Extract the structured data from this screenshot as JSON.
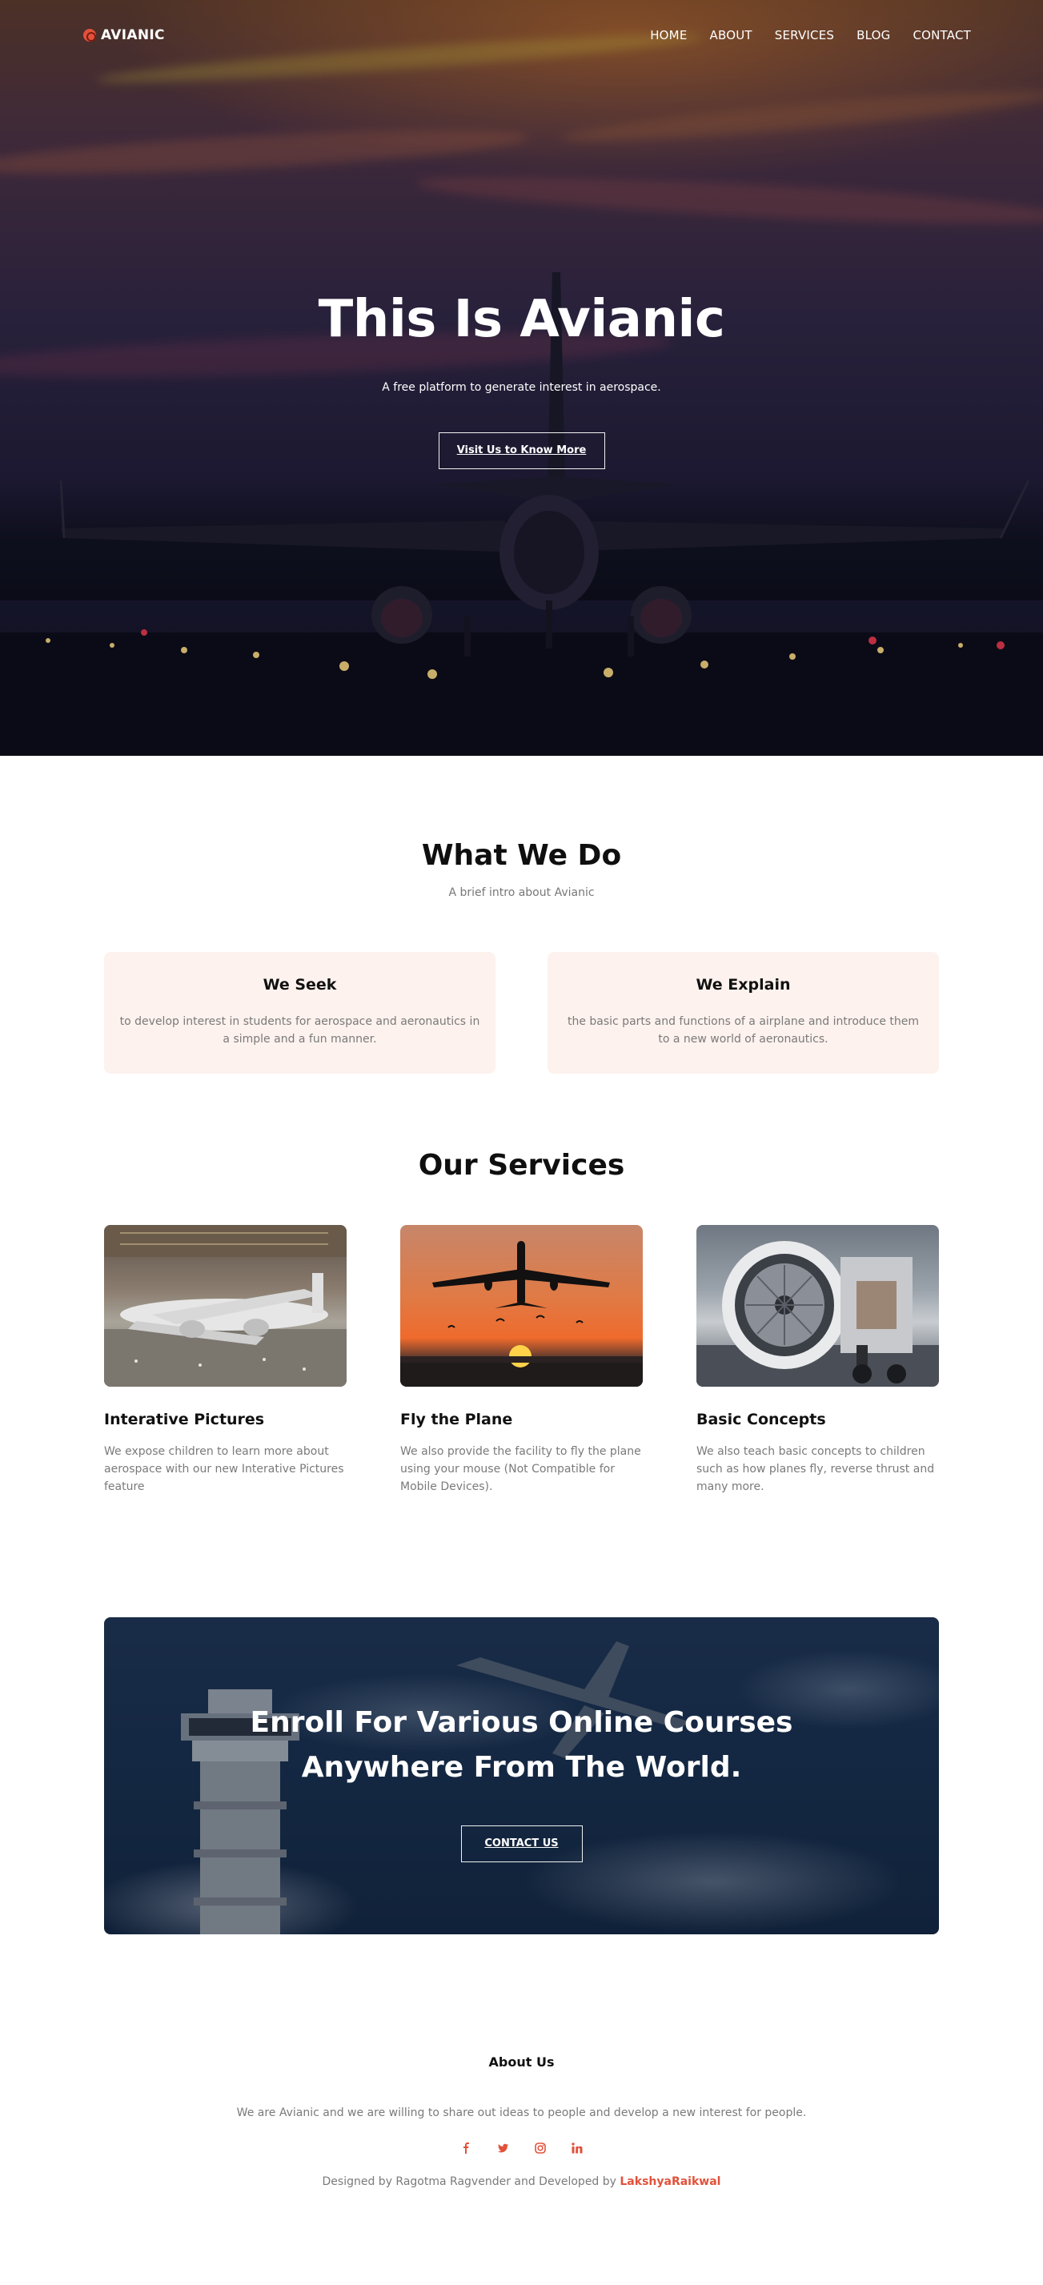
{
  "brand": {
    "name": "AVIANIC"
  },
  "nav": {
    "items": [
      "HOME",
      "ABOUT",
      "SERVICES",
      "BLOG",
      "CONTACT"
    ]
  },
  "hero": {
    "title": "This Is Avianic",
    "subtitle": "A free platform to generate interest in aerospace.",
    "button": "Visit Us to Know More"
  },
  "what_we_do": {
    "title": "What We Do",
    "subtitle": "A brief intro about Avianic",
    "cards": [
      {
        "title": "We Seek",
        "text": "to develop interest in students for aerospace and aeronautics in a simple and a fun manner."
      },
      {
        "title": "We Explain",
        "text": "the basic parts and functions of a airplane and introduce them to a new world of aeronautics."
      }
    ]
  },
  "services": {
    "title": "Our Services",
    "items": [
      {
        "title": "Interative Pictures",
        "text": "We expose children to learn more about aerospace with our new Interative Pictures feature"
      },
      {
        "title": "Fly the Plane",
        "text": "We also provide the facility to fly the plane using your mouse (Not Compatible for Mobile Devices)."
      },
      {
        "title": "Basic Concepts",
        "text": "We also teach basic concepts to children such as how planes fly, reverse thrust and many more."
      }
    ]
  },
  "enroll": {
    "title_line1": "Enroll For Various Online Courses",
    "title_line2": "Anywhere From The World.",
    "button": "CONTACT US"
  },
  "footer": {
    "title": "About Us",
    "text": "We are Avianic and we are willing to share out ideas to people and develop a new interest for people.",
    "credits_prefix": "Designed by Ragotma Ragvender and Developed by ",
    "developer": "LakshyaRaikwal",
    "social_icons": [
      "facebook-icon",
      "twitter-icon",
      "instagram-icon",
      "linkedin-icon"
    ]
  },
  "colors": {
    "accent": "#e2513a",
    "card_bg": "#fdf2ee"
  }
}
